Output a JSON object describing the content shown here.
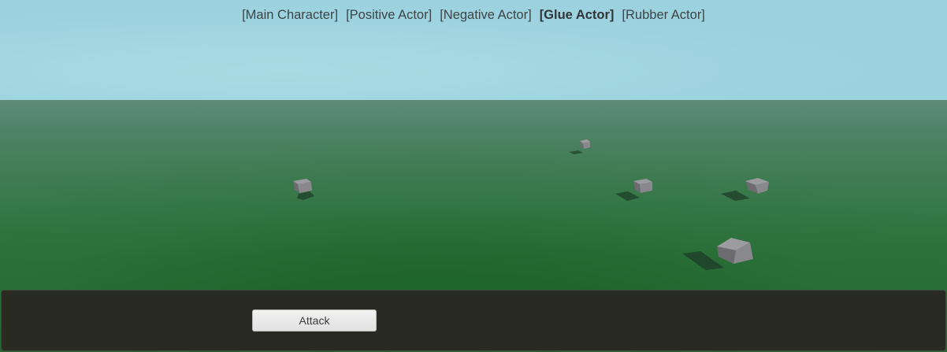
{
  "actor_menu": {
    "items": [
      {
        "label": "[Main Character]",
        "active": false
      },
      {
        "label": "[Positive Actor]",
        "active": false
      },
      {
        "label": "[Negative Actor]",
        "active": false
      },
      {
        "label": "[Glue Actor]",
        "active": true
      },
      {
        "label": "[Rubber Actor]",
        "active": false
      }
    ]
  },
  "controls": {
    "attack_label": "Attack"
  },
  "colors": {
    "sky": "#9dd3df",
    "ground": "#226a30",
    "panel": "#292a22",
    "cube_top": "#9a9a9e",
    "cube_front": "#7d7d82",
    "cube_side": "#5e5e64",
    "shadow": "#1f3d2a"
  }
}
